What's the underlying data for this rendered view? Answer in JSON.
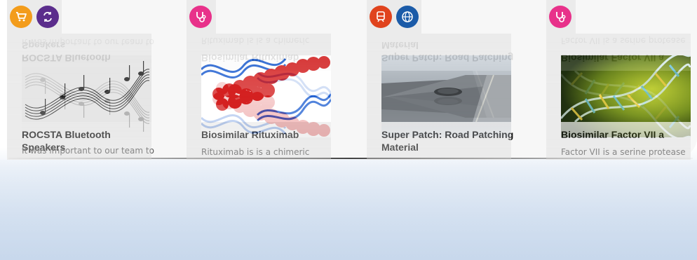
{
  "cards": [
    {
      "title": "ROCSTA Bluetooth Speakers",
      "description": "It was important to our team to",
      "badges": [
        "cart-icon",
        "refresh-icon"
      ],
      "image": "music-staff-notes"
    },
    {
      "title": "Biosimilar Rituximab",
      "description": "Rituximab is is a chimeric",
      "badges": [
        "stethoscope-icon"
      ],
      "image": "protein-dna-strands"
    },
    {
      "title": "Super Patch: Road Patching Material",
      "description": "",
      "badges": [
        "train-icon",
        "globe-icon"
      ],
      "image": "pothole-road"
    },
    {
      "title": "Biosimilar Factor VII a",
      "description": "Factor VII is a serine protease",
      "badges": [
        "stethoscope-icon"
      ],
      "image": "dna-helix-green"
    }
  ],
  "colors": {
    "orange": "#f39c1b",
    "purple": "#5b2d8c",
    "pink": "#e8318a",
    "red": "#e0431d",
    "blue": "#1b5ba8",
    "card_bg": "#ebebeb"
  }
}
